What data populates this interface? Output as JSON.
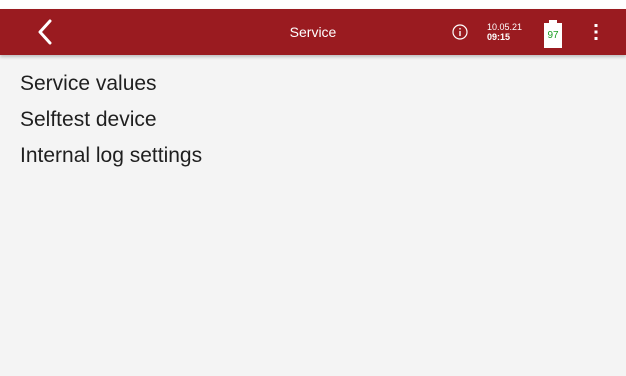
{
  "header": {
    "title": "Service",
    "date": "10.05.21",
    "time": "09:15",
    "battery_level": "97",
    "back_icon": "chevron-left-icon",
    "info_icon": "info-icon",
    "menu_icon": "more-vertical-icon",
    "bar_color": "#9a1b20",
    "battery_text_color": "#1a9e22"
  },
  "menu": {
    "items": [
      {
        "label": "Service values"
      },
      {
        "label": "Selftest device"
      },
      {
        "label": "Internal log settings"
      }
    ]
  }
}
